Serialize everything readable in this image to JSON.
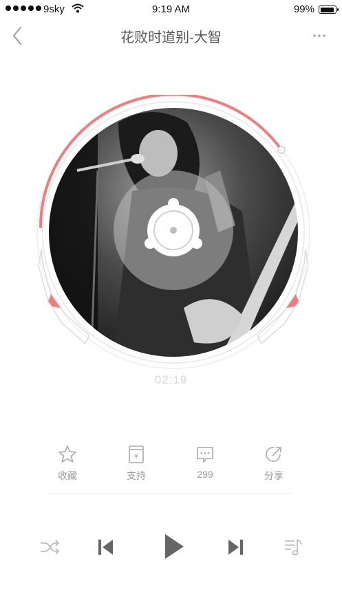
{
  "status_bar": {
    "carrier": "9sky",
    "time": "9:19 AM",
    "battery_percent": "99%",
    "battery_level": 0.99,
    "signal_dots": 5
  },
  "nav": {
    "back_icon": "chevron-left-icon",
    "title": "花败时道别-大智",
    "more_icon": "more-dots-icon"
  },
  "player": {
    "elapsed_time": "02:19",
    "progress_icon_color": "#f07d7d",
    "cover_icon": "album-cover-photo"
  },
  "actions": [
    {
      "id": "favorite",
      "label": "收藏",
      "icon": "star-icon"
    },
    {
      "id": "support",
      "label": "支持",
      "icon": "yen-tag-icon"
    },
    {
      "id": "comments",
      "label": "299",
      "icon": "comment-icon"
    },
    {
      "id": "share",
      "label": "分享",
      "icon": "share-icon"
    }
  ],
  "controls": {
    "shuffle_icon": "shuffle-icon",
    "prev_icon": "previous-icon",
    "play_icon": "play-icon",
    "next_icon": "next-icon",
    "playlist_icon": "playlist-icon"
  },
  "colors": {
    "accent": "#f07d7d",
    "icon_gray": "#a8a8a8",
    "control_dark": "#666666"
  }
}
